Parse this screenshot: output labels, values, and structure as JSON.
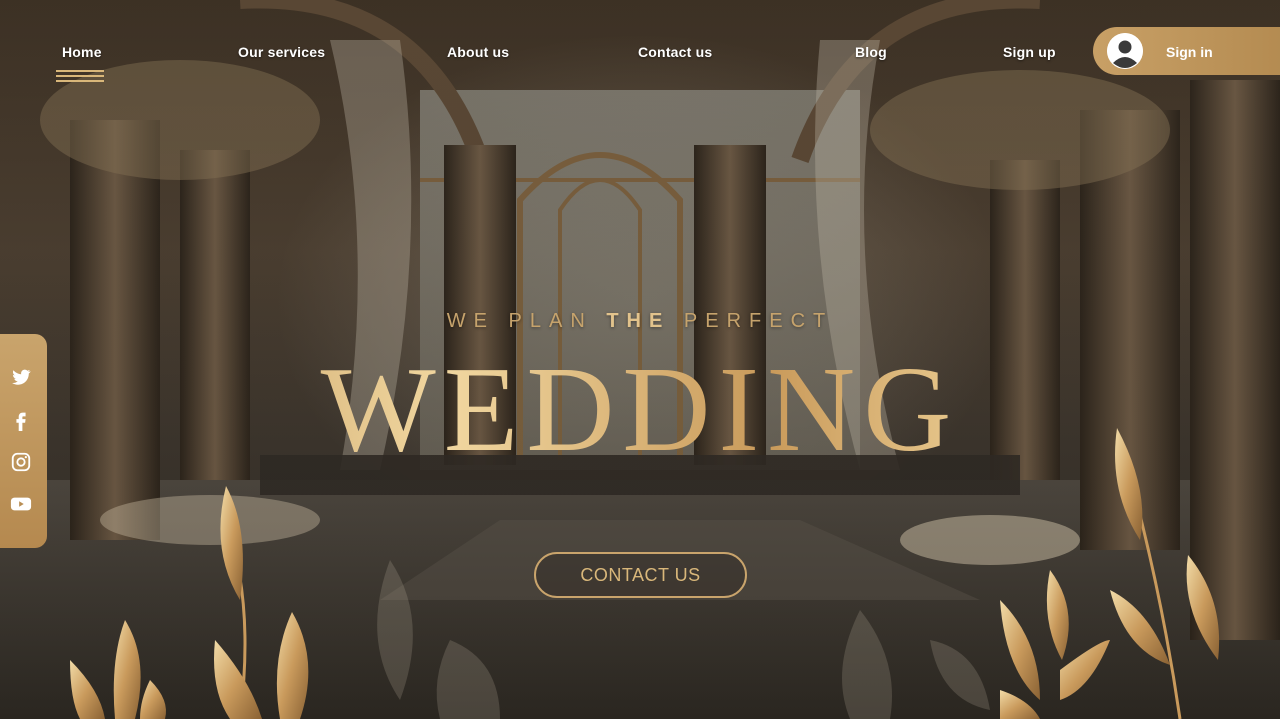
{
  "nav": {
    "home": "Home",
    "services": "Our services",
    "about": "About us",
    "contact": "Contact us",
    "blog": "Blog",
    "signup": "Sign up",
    "signin": "Sign in"
  },
  "hero": {
    "subtitle_part1": "WE PLAN ",
    "subtitle_bold": "THE",
    "subtitle_part2": " PERFECT",
    "title": "WEDDING",
    "cta": "CONTACT US"
  },
  "social": [
    "twitter-icon",
    "facebook-icon",
    "instagram-icon",
    "youtube-icon"
  ],
  "colors": {
    "accent_gold": "#c9a46c",
    "gold_light": "#f1d7a0",
    "text_white": "#ffffff"
  }
}
